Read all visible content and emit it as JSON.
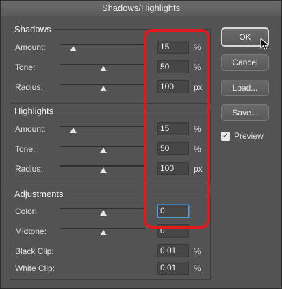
{
  "window": {
    "title": "Shadows/Highlights"
  },
  "shadows": {
    "title": "Shadows",
    "rows": [
      {
        "label": "Amount:",
        "value": "15",
        "unit": "%",
        "slider_fraction": 0.15
      },
      {
        "label": "Tone:",
        "value": "50",
        "unit": "%",
        "slider_fraction": 0.5
      },
      {
        "label": "Radius:",
        "value": "100",
        "unit": "px",
        "slider_fraction": 0.5
      }
    ]
  },
  "highlights": {
    "title": "Highlights",
    "rows": [
      {
        "label": "Amount:",
        "value": "15",
        "unit": "%",
        "slider_fraction": 0.15
      },
      {
        "label": "Tone:",
        "value": "50",
        "unit": "%",
        "slider_fraction": 0.5
      },
      {
        "label": "Radius:",
        "value": "100",
        "unit": "px",
        "slider_fraction": 0.5
      }
    ]
  },
  "adjustments": {
    "title": "Adjustments",
    "color": {
      "label": "Color:",
      "value": "0",
      "slider_fraction": 0.5
    },
    "midtone": {
      "label": "Midtone:",
      "value": "0",
      "slider_fraction": 0.5
    },
    "black_clip": {
      "label": "Black Clip:",
      "value": "0.01",
      "unit": "%"
    },
    "white_clip": {
      "label": "White Clip:",
      "value": "0.01",
      "unit": "%"
    }
  },
  "buttons": {
    "ok": "OK",
    "cancel": "Cancel",
    "load": "Load...",
    "save": "Save..."
  },
  "preview": {
    "label": "Preview",
    "checked": true,
    "check_glyph": "✓"
  },
  "colors": {
    "panel_bg": "#535353",
    "highlight_outline": "#e0191e",
    "focus_blue": "#5b9bd5"
  }
}
